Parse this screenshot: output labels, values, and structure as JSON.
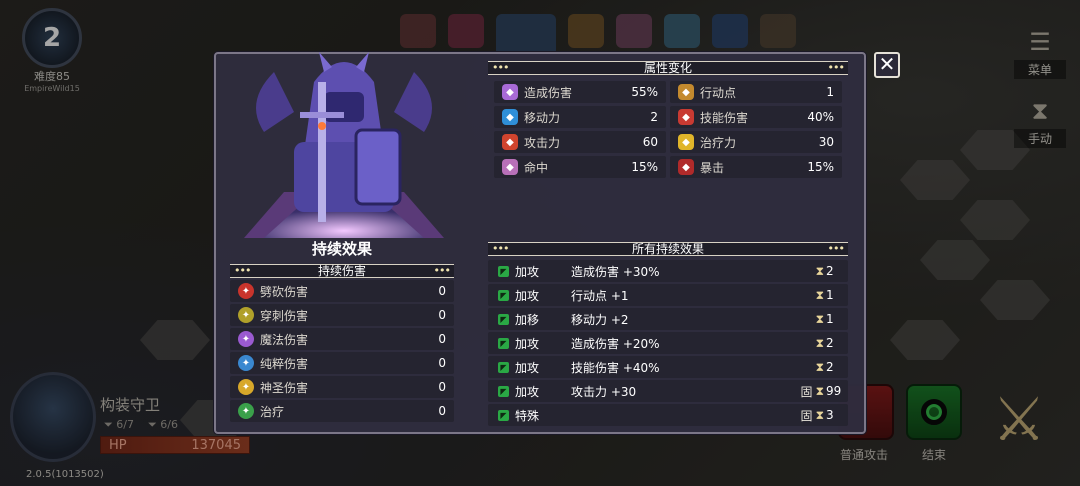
{
  "difficulty": {
    "number": "2",
    "label": "难度85",
    "username": "EmpireWild15"
  },
  "menu": {
    "menu_label": "菜单",
    "manual_label": "手动"
  },
  "unit": {
    "name": "构装守卫",
    "stat1": "6/7",
    "stat2": "6/6",
    "hp_label": "HP",
    "hp_value": "137045"
  },
  "version": "2.0.5(1013502)",
  "actions": {
    "normal_attack": "普通攻击",
    "end": "结束"
  },
  "modal": {
    "portrait_title": "持续效果",
    "attr_header": "属性变化",
    "attributes": [
      {
        "label": "造成伤害",
        "value": "55%",
        "color": "#a86ad6",
        "icon": "damage-icon"
      },
      {
        "label": "行动点",
        "value": "1",
        "color": "#c48a2e",
        "icon": "action-point-icon"
      },
      {
        "label": "移动力",
        "value": "2",
        "color": "#2f8fd8",
        "icon": "movement-icon"
      },
      {
        "label": "技能伤害",
        "value": "40%",
        "color": "#c83a32",
        "icon": "skill-damage-icon"
      },
      {
        "label": "攻击力",
        "value": "60",
        "color": "#d0442e",
        "icon": "attack-icon"
      },
      {
        "label": "治疗力",
        "value": "30",
        "color": "#e0b52a",
        "icon": "heal-power-icon"
      },
      {
        "label": "命中",
        "value": "15%",
        "color": "#b870b8",
        "icon": "hit-icon"
      },
      {
        "label": "暴击",
        "value": "15%",
        "color": "#b02a2a",
        "icon": "crit-icon"
      }
    ],
    "dot_header": "持续伤害",
    "dots": [
      {
        "label": "劈砍伤害",
        "value": "0",
        "color": "#c8342c",
        "icon": "slash-icon"
      },
      {
        "label": "穿刺伤害",
        "value": "0",
        "color": "#b0a02a",
        "icon": "pierce-icon"
      },
      {
        "label": "魔法伤害",
        "value": "0",
        "color": "#9a5ad0",
        "icon": "magic-icon"
      },
      {
        "label": "纯粹伤害",
        "value": "0",
        "color": "#3a88d0",
        "icon": "pure-icon"
      },
      {
        "label": "神圣伤害",
        "value": "0",
        "color": "#d8a82a",
        "icon": "holy-icon"
      },
      {
        "label": "治疗",
        "value": "0",
        "color": "#3aa04a",
        "icon": "heal-icon"
      }
    ],
    "effects_header": "所有持续效果",
    "effects": [
      {
        "type": "加攻",
        "desc": "造成伤害 +30%",
        "lock": "",
        "turns": "2"
      },
      {
        "type": "加攻",
        "desc": "行动点 +1",
        "lock": "",
        "turns": "1"
      },
      {
        "type": "加移",
        "desc": "移动力 +2",
        "lock": "",
        "turns": "1"
      },
      {
        "type": "加攻",
        "desc": "造成伤害 +20%",
        "lock": "",
        "turns": "2"
      },
      {
        "type": "加攻",
        "desc": "技能伤害 +40%",
        "lock": "",
        "turns": "2"
      },
      {
        "type": "加攻",
        "desc": "攻击力 +30",
        "lock": "固",
        "turns": "99"
      },
      {
        "type": "特殊",
        "desc": "",
        "lock": "固",
        "turns": "3"
      }
    ]
  }
}
